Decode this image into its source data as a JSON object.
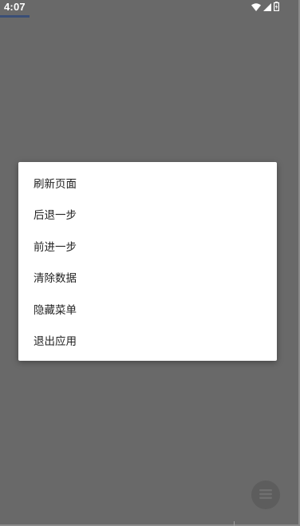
{
  "status_bar": {
    "time": "4:07",
    "icons": [
      "wifi-icon",
      "signal-icon",
      "battery-icon"
    ]
  },
  "menu": {
    "items": [
      {
        "label": "刷新页面"
      },
      {
        "label": "后退一步"
      },
      {
        "label": "前进一步"
      },
      {
        "label": "清除数据"
      },
      {
        "label": "隐藏菜单"
      },
      {
        "label": "退出应用"
      }
    ]
  },
  "fab": {
    "icon": "menu-icon"
  },
  "colors": {
    "scrim": "#696969",
    "menu_background": "#ffffff",
    "progress_accent": "#3a4e76"
  }
}
